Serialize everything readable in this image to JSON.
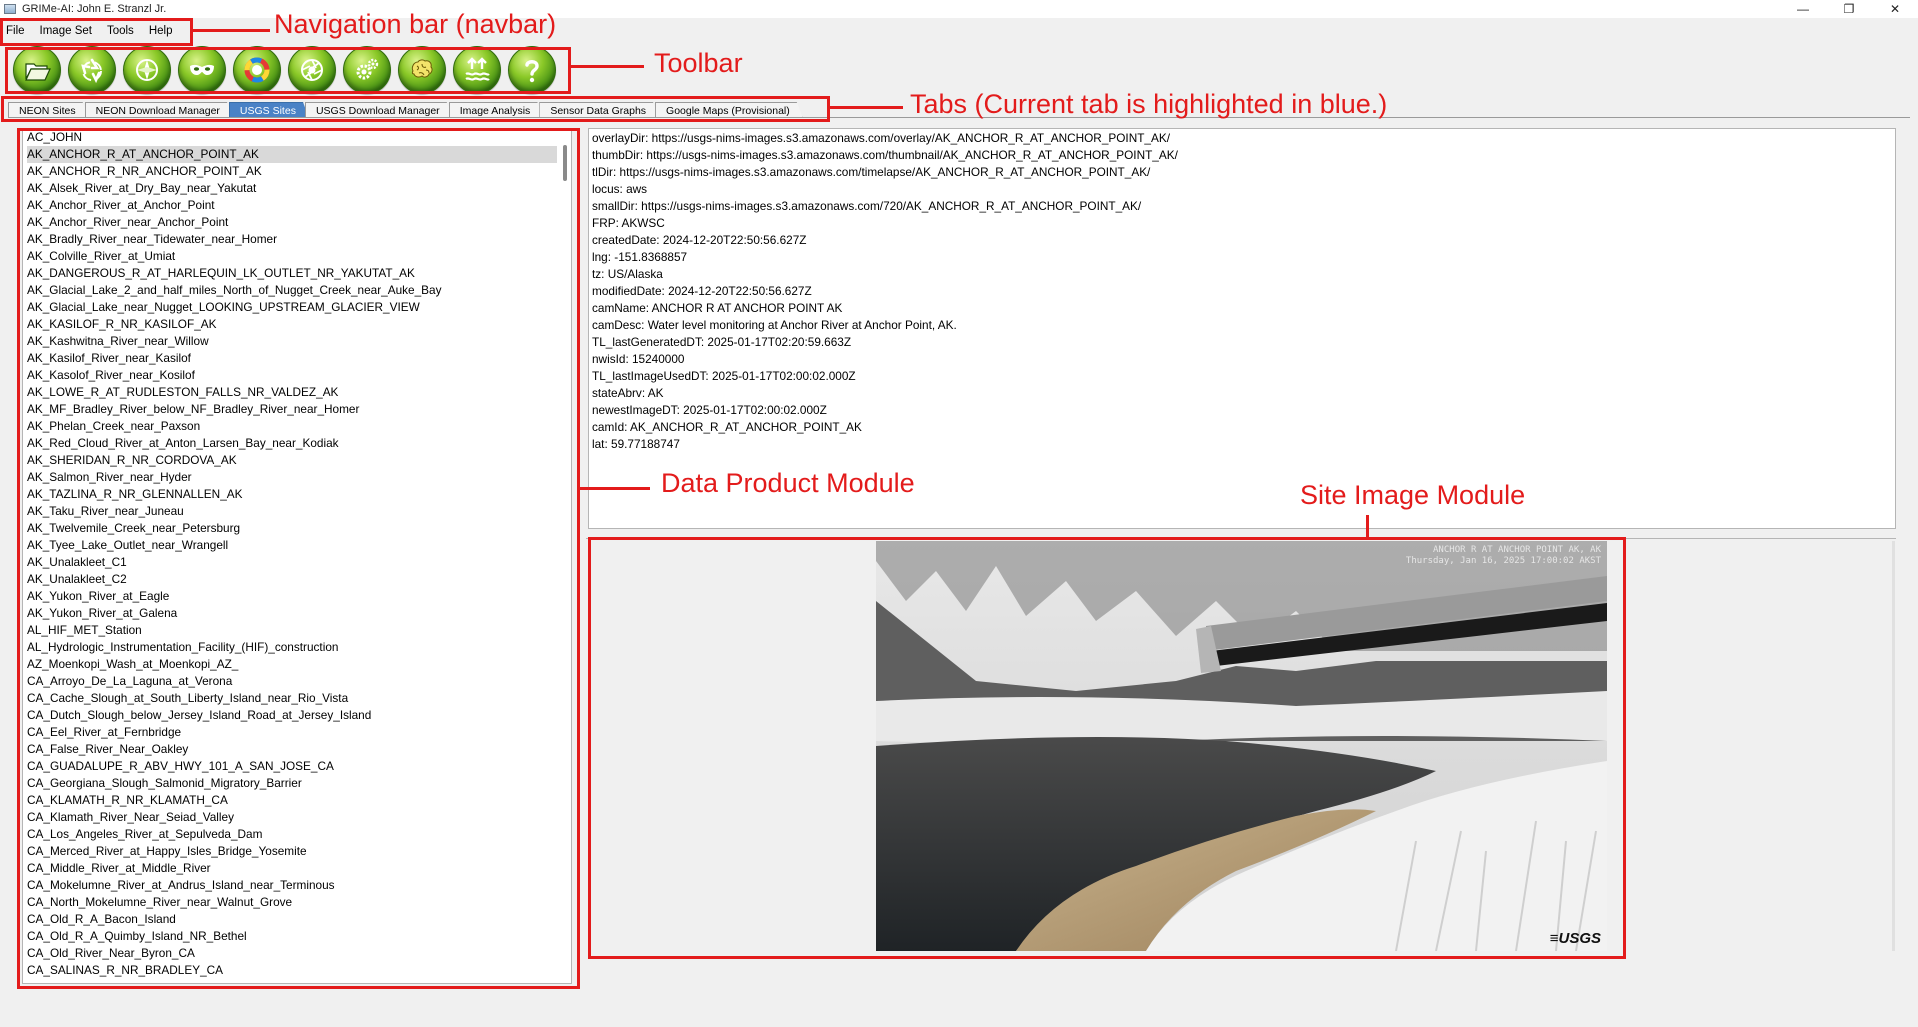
{
  "window": {
    "title": "GRIMe-AI: John E. Stranzl Jr.",
    "minimize": "—",
    "maximize": "❐",
    "close": "✕"
  },
  "menu": [
    "File",
    "Image Set",
    "Tools",
    "Help"
  ],
  "toolbar": [
    {
      "icon": "folder-open-icon"
    },
    {
      "icon": "recycle-icon"
    },
    {
      "icon": "compass-icon"
    },
    {
      "icon": "mask-icon"
    },
    {
      "icon": "color-wheel-icon"
    },
    {
      "icon": "camera-aperture-icon"
    },
    {
      "icon": "gears-icon"
    },
    {
      "icon": "brain-icon"
    },
    {
      "icon": "water-level-icon"
    },
    {
      "icon": "help-icon"
    }
  ],
  "tabs": [
    {
      "label": "NEON Sites",
      "active": false
    },
    {
      "label": "NEON Download Manager",
      "active": false
    },
    {
      "label": "USGS Sites",
      "active": true
    },
    {
      "label": "USGS Download Manager",
      "active": false
    },
    {
      "label": "Image Analysis",
      "active": false
    },
    {
      "label": "Sensor Data Graphs",
      "active": false
    },
    {
      "label": "Google Maps (Provisional)",
      "active": false
    }
  ],
  "annotations": {
    "navbar": "Navigation bar (navbar)",
    "toolbar": "Toolbar",
    "tabs": "Tabs (Current tab is highlighted in blue.)",
    "data_product": "Data Product Module",
    "site_image": "Site Image Module"
  },
  "sites": [
    "AC_JOHN",
    "AK_ANCHOR_R_AT_ANCHOR_POINT_AK",
    "AK_ANCHOR_R_NR_ANCHOR_POINT_AK",
    "AK_Alsek_River_at_Dry_Bay_near_Yakutat",
    "AK_Anchor_River_at_Anchor_Point",
    "AK_Anchor_River_near_Anchor_Point",
    "AK_Bradly_River_near_Tidewater_near_Homer",
    "AK_Colville_River_at_Umiat",
    "AK_DANGEROUS_R_AT_HARLEQUIN_LK_OUTLET_NR_YAKUTAT_AK",
    "AK_Glacial_Lake_2_and_half_miles_North_of_Nugget_Creek_near_Auke_Bay",
    "AK_Glacial_Lake_near_Nugget_LOOKING_UPSTREAM_GLACIER_VIEW",
    "AK_KASILOF_R_NR_KASILOF_AK",
    "AK_Kashwitna_River_near_Willow",
    "AK_Kasilof_River_near_Kasilof",
    "AK_Kasolof_River_near_Kosilof",
    "AK_LOWE_R_AT_RUDLESTON_FALLS_NR_VALDEZ_AK",
    "AK_MF_Bradley_River_below_NF_Bradley_River_near_Homer",
    "AK_Phelan_Creek_near_Paxson",
    "AK_Red_Cloud_River_at_Anton_Larsen_Bay_near_Kodiak",
    "AK_SHERIDAN_R_NR_CORDOVA_AK",
    "AK_Salmon_River_near_Hyder",
    "AK_TAZLINA_R_NR_GLENNALLEN_AK",
    "AK_Taku_River_near_Juneau",
    "AK_Twelvemile_Creek_near_Petersburg",
    "AK_Tyee_Lake_Outlet_near_Wrangell",
    "AK_Unalakleet_C1",
    "AK_Unalakleet_C2",
    "AK_Yukon_River_at_Eagle",
    "AK_Yukon_River_at_Galena",
    "AL_HIF_MET_Station",
    "AL_Hydrologic_Instrumentation_Facility_(HIF)_construction",
    "AZ_Moenkopi_Wash_at_Moenkopi_AZ_",
    "CA_Arroyo_De_La_Laguna_at_Verona",
    "CA_Cache_Slough_at_South_Liberty_Island_near_Rio_Vista",
    "CA_Dutch_Slough_below_Jersey_Island_Road_at_Jersey_Island",
    "CA_Eel_River_at_Fernbridge",
    "CA_False_River_Near_Oakley",
    "CA_GUADALUPE_R_ABV_HWY_101_A_SAN_JOSE_CA",
    "CA_Georgiana_Slough_Salmonid_Migratory_Barrier",
    "CA_KLAMATH_R_NR_KLAMATH_CA",
    "CA_Klamath_River_Near_Seiad_Valley",
    "CA_Los_Angeles_River_at_Sepulveda_Dam",
    "CA_Merced_River_at_Happy_Isles_Bridge_Yosemite",
    "CA_Middle_River_at_Middle_River",
    "CA_Mokelumne_River_at_Andrus_Island_near_Terminous",
    "CA_North_Mokelumne_River_near_Walnut_Grove",
    "CA_Old_R_A_Bacon_Island",
    "CA_Old_R_A_Quimby_Island_NR_Bethel",
    "CA_Old_River_Near_Byron_CA",
    "CA_SALINAS_R_NR_BRADLEY_CA"
  ],
  "selected_site_index": 1,
  "site_info": [
    "overlayDir: https://usgs-nims-images.s3.amazonaws.com/overlay/AK_ANCHOR_R_AT_ANCHOR_POINT_AK/",
    "thumbDir: https://usgs-nims-images.s3.amazonaws.com/thumbnail/AK_ANCHOR_R_AT_ANCHOR_POINT_AK/",
    "tlDir: https://usgs-nims-images.s3.amazonaws.com/timelapse/AK_ANCHOR_R_AT_ANCHOR_POINT_AK/",
    "locus: aws",
    "smallDir: https://usgs-nims-images.s3.amazonaws.com/720/AK_ANCHOR_R_AT_ANCHOR_POINT_AK/",
    "FRP: AKWSC",
    "createdDate: 2024-12-20T22:50:56.627Z",
    "lng: -151.8368857",
    "tz: US/Alaska",
    "modifiedDate: 2024-12-20T22:50:56.627Z",
    "camName: ANCHOR R AT ANCHOR POINT AK",
    "camDesc: Water level monitoring at Anchor River at Anchor Point, AK.",
    "TL_lastGeneratedDT: 2025-01-17T02:20:59.663Z",
    "nwisId: 15240000",
    "TL_lastImageUsedDT: 2025-01-17T02:00:02.000Z",
    "stateAbrv: AK",
    "newestImageDT: 2025-01-17T02:00:02.000Z",
    "camId: AK_ANCHOR_R_AT_ANCHOR_POINT_AK",
    "lat: 59.77188747"
  ],
  "image": {
    "caption_line1": "ANCHOR R AT ANCHOR POINT AK, AK",
    "caption_line2": "Thursday, Jan 16, 2025  17:00:02 AKST",
    "logo": "≡USGS"
  }
}
